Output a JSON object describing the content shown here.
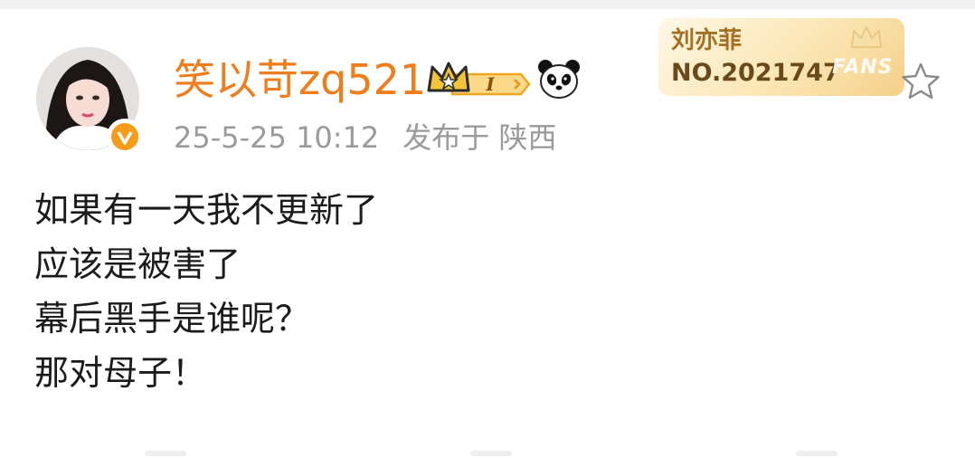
{
  "post": {
    "username": "笑以苛zq521",
    "level_badge": "I",
    "date": "25-5-25 10:12",
    "source": "发布于 陕西",
    "fan_card": {
      "name": "刘亦菲",
      "number": "NO.2021747",
      "label": "FANS"
    },
    "content_lines": [
      "如果有一天我不更新了",
      "应该是被害了",
      "幕后黑手是谁呢？",
      "那对母子！"
    ]
  },
  "icons": {
    "avatar": "user-avatar",
    "verified": "verified-v-icon",
    "crown": "crown-badge-icon",
    "panda": "panda-emoji-icon",
    "star": "star-outline-icon"
  },
  "colors": {
    "username": "#f07d1c",
    "meta": "#9a9a9a",
    "verified": "#f59d1a",
    "fans_card": "#fbe6b5",
    "content": "#1b1b1b"
  }
}
